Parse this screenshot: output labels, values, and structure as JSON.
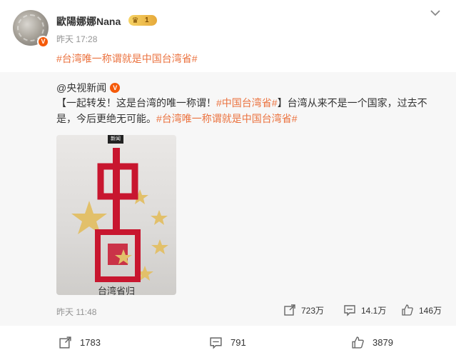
{
  "post": {
    "username": "歐陽娜娜Nana",
    "level_badge": "1",
    "time": "昨天 17:28",
    "hashtag_text": "#台湾唯一称谓就是中国台湾省#",
    "icons": {
      "avatar_badge": "verified-v-icon",
      "menu": "chevron-down-icon"
    }
  },
  "repost": {
    "author": "@央视新闻",
    "text_part1": "【一起转发！这是台湾的唯一称谓！",
    "tag1": "#中国台湾省#",
    "text_part2": "】台湾从来不是一个国家，过去不是，今后更绝无可能。",
    "tag2": "#台湾唯一称谓就是中国台湾省#",
    "image_badge": "新闻",
    "image_caption": "台湾省归",
    "time": "昨天 11:48",
    "stats": {
      "reposts": "723万",
      "comments": "14.1万",
      "likes": "146万"
    }
  },
  "actions": {
    "reposts": "1783",
    "comments": "791",
    "likes": "3879"
  },
  "colors": {
    "accent": "#eb7340",
    "badge": "#f55a0a",
    "repost_bg": "#f7f7f7"
  }
}
